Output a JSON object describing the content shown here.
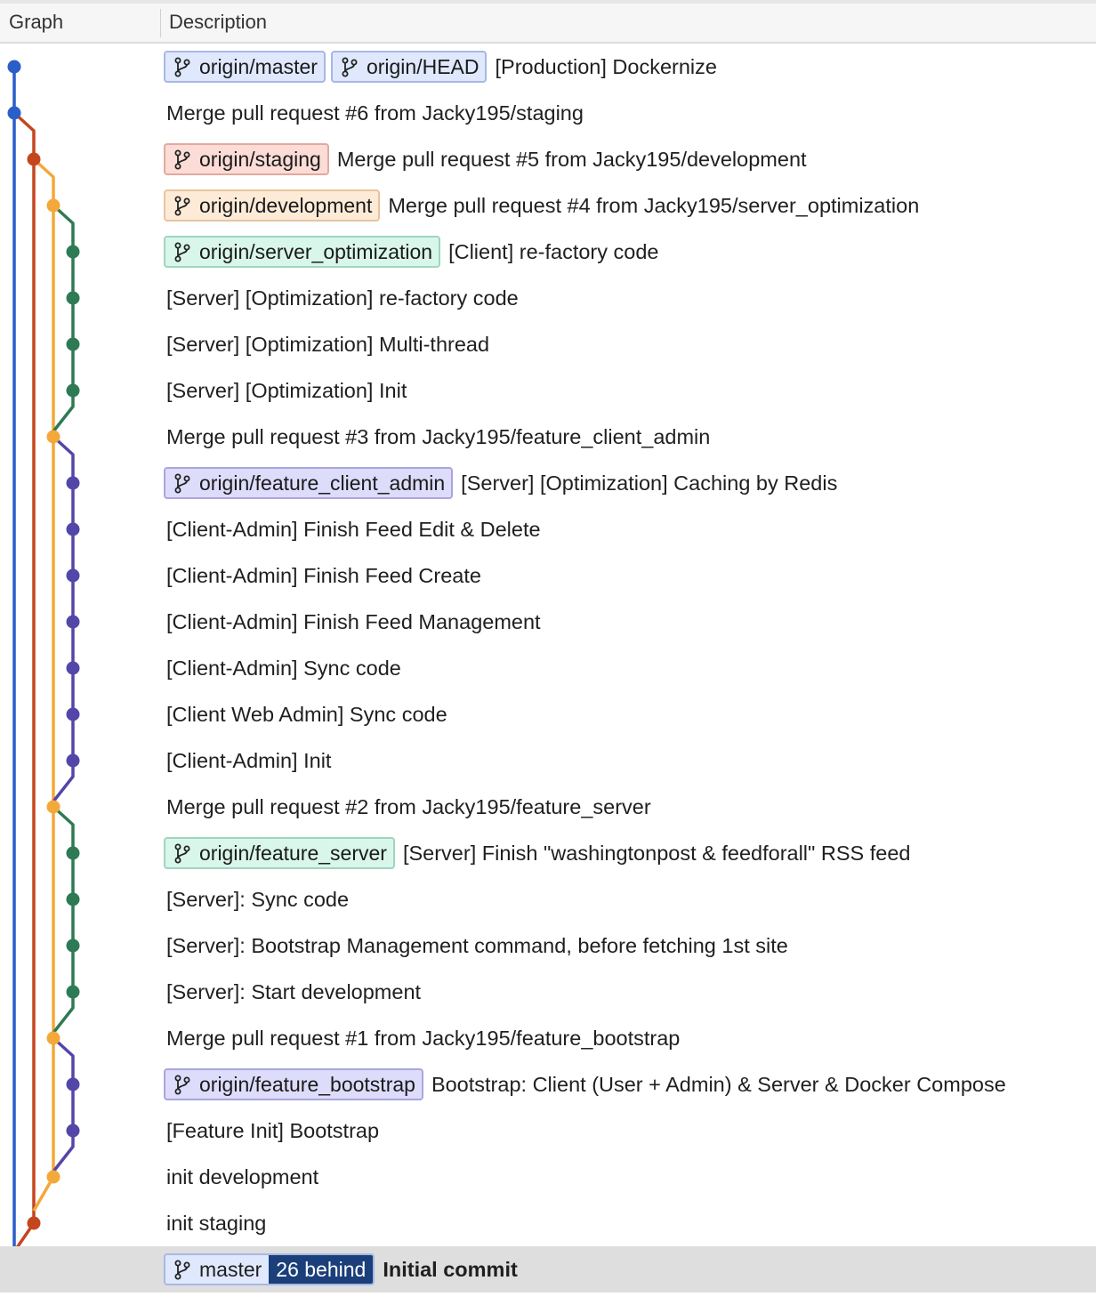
{
  "header": {
    "graph_label": "Graph",
    "description_label": "Description"
  },
  "colors": {
    "master": "#2a5fc7",
    "staging": "#c4461e",
    "development": "#f4a83a",
    "server_optimization": "#2e7a55",
    "feature_client_admin": "#5247a8",
    "feature_server": "#2e7a55",
    "feature_bootstrap": "#5247a8"
  },
  "commits": [
    {
      "refs": [
        {
          "name": "origin/master",
          "style": "blue"
        },
        {
          "name": "origin/HEAD",
          "style": "blue"
        }
      ],
      "message": "[Production] Dockernize"
    },
    {
      "refs": [],
      "message": "Merge pull request #6 from Jacky195/staging"
    },
    {
      "refs": [
        {
          "name": "origin/staging",
          "style": "red"
        }
      ],
      "message": "Merge pull request #5 from Jacky195/development"
    },
    {
      "refs": [
        {
          "name": "origin/development",
          "style": "orange"
        }
      ],
      "message": "Merge pull request #4 from Jacky195/server_optimization"
    },
    {
      "refs": [
        {
          "name": "origin/server_optimization",
          "style": "green"
        }
      ],
      "message": "[Client] re-factory code"
    },
    {
      "refs": [],
      "message": "[Server] [Optimization] re-factory code"
    },
    {
      "refs": [],
      "message": "[Server] [Optimization] Multi-thread"
    },
    {
      "refs": [],
      "message": "[Server] [Optimization] Init"
    },
    {
      "refs": [],
      "message": "Merge pull request #3 from Jacky195/feature_client_admin"
    },
    {
      "refs": [
        {
          "name": "origin/feature_client_admin",
          "style": "purple"
        }
      ],
      "message": "[Server] [Optimization] Caching by Redis"
    },
    {
      "refs": [],
      "message": "[Client-Admin] Finish Feed Edit & Delete"
    },
    {
      "refs": [],
      "message": "[Client-Admin] Finish Feed Create"
    },
    {
      "refs": [],
      "message": "[Client-Admin] Finish Feed Management"
    },
    {
      "refs": [],
      "message": "[Client-Admin] Sync code"
    },
    {
      "refs": [],
      "message": "[Client Web Admin] Sync code"
    },
    {
      "refs": [],
      "message": "[Client-Admin] Init"
    },
    {
      "refs": [],
      "message": "Merge pull request #2 from Jacky195/feature_server"
    },
    {
      "refs": [
        {
          "name": "origin/feature_server",
          "style": "green"
        }
      ],
      "message": "[Server] Finish \"washingtonpost & feedforall\" RSS feed"
    },
    {
      "refs": [],
      "message": "[Server]: Sync code"
    },
    {
      "refs": [],
      "message": "[Server]: Bootstrap Management command, before fetching 1st site"
    },
    {
      "refs": [],
      "message": "[Server]: Start development"
    },
    {
      "refs": [],
      "message": "Merge pull request #1 from Jacky195/feature_bootstrap"
    },
    {
      "refs": [
        {
          "name": "origin/feature_bootstrap",
          "style": "purple"
        }
      ],
      "message": "Bootstrap: Client (User + Admin) & Server & Docker Compose"
    },
    {
      "refs": [],
      "message": "[Feature Init] Bootstrap"
    },
    {
      "refs": [],
      "message": "init development"
    },
    {
      "refs": [],
      "message": "init staging"
    },
    {
      "refs": [
        {
          "name": "master",
          "style": "master",
          "behind": "26 behind"
        }
      ],
      "message": "Initial commit",
      "selected": true,
      "bold": true
    }
  ]
}
